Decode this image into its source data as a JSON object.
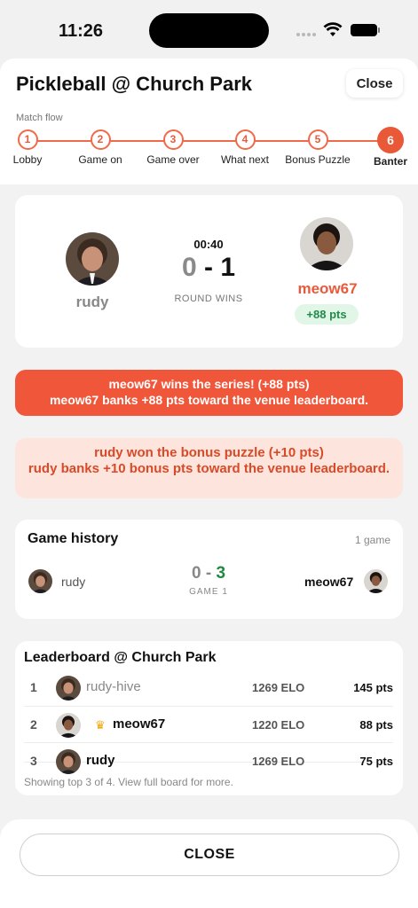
{
  "status_bar": {
    "time": "11:26"
  },
  "header": {
    "title": "Pickleball @ Church Park",
    "close_label": "Close"
  },
  "match_flow": {
    "label": "Match flow",
    "steps": [
      {
        "number": "1",
        "label": "Lobby"
      },
      {
        "number": "2",
        "label": "Game on"
      },
      {
        "number": "3",
        "label": "Game over"
      },
      {
        "number": "4",
        "label": "What next"
      },
      {
        "number": "5",
        "label": "Bonus Puzzle"
      },
      {
        "number": "6",
        "label": "Banter",
        "active": true
      }
    ]
  },
  "scoreboard": {
    "left_player": "rudy",
    "right_player": "meow67",
    "timer": "00:40",
    "left_score": "0",
    "separator": " - ",
    "right_score": "1",
    "caption": "ROUND WINS",
    "right_points_badge": "+88 pts"
  },
  "banners": {
    "series_line1": "meow67 wins the series! (+88 pts)",
    "series_line2": "meow67 banks +88 pts toward the venue leaderboard.",
    "bonus_line1": "rudy won the bonus puzzle (+10 pts)",
    "bonus_line2": "rudy banks +10 bonus pts toward the venue leaderboard."
  },
  "game_history": {
    "title": "Game history",
    "count": "1 game",
    "games": [
      {
        "left": "rudy",
        "left_score": "0",
        "sep": " - ",
        "right_score": "3",
        "right": "meow67",
        "label": "GAME 1"
      }
    ]
  },
  "leaderboard": {
    "title": "Leaderboard @ Church Park",
    "rows": [
      {
        "rank": "1",
        "name": "rudy-hive",
        "elo": "1269 ELO",
        "pts": "145 pts"
      },
      {
        "rank": "2",
        "name": "meow67",
        "elo": "1220 ELO",
        "pts": "88 pts",
        "crown": true
      },
      {
        "rank": "3",
        "name": "rudy",
        "elo": "1269 ELO",
        "pts": "75 pts"
      }
    ],
    "footer": "Showing top 3 of 4. View full board for more."
  },
  "footer": {
    "close_label": "CLOSE"
  },
  "colors": {
    "accent": "#e95837",
    "success": "#1f8a3f",
    "muted": "#888888"
  }
}
